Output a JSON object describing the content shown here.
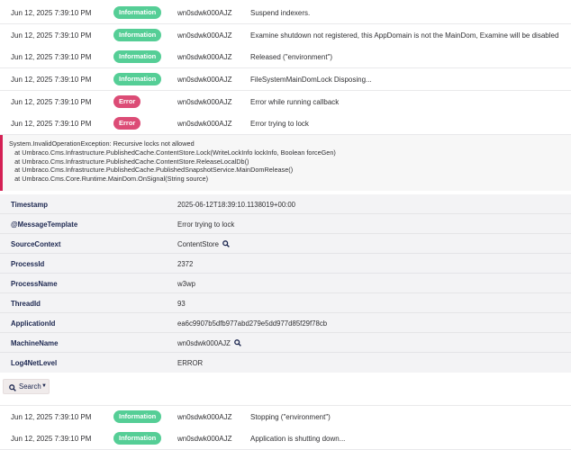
{
  "log_rows_top": [
    {
      "timestamp": "Jun 12, 2025 7:39:10 PM",
      "level": "Information",
      "machine": "wn0sdwk000AJZ",
      "message": "Suspend indexers."
    },
    {
      "timestamp": "Jun 12, 2025 7:39:10 PM",
      "level": "Information",
      "machine": "wn0sdwk000AJZ",
      "message": "Examine shutdown not registered, this AppDomain is not the MainDom, Examine will be disabled"
    },
    {
      "timestamp": "Jun 12, 2025 7:39:10 PM",
      "level": "Information",
      "machine": "wn0sdwk000AJZ",
      "message": "Released (\"environment\")"
    },
    {
      "timestamp": "Jun 12, 2025 7:39:10 PM",
      "level": "Information",
      "machine": "wn0sdwk000AJZ",
      "message": "FileSystemMainDomLock Disposing..."
    },
    {
      "timestamp": "Jun 12, 2025 7:39:10 PM",
      "level": "Error",
      "machine": "wn0sdwk000AJZ",
      "message": "Error while running callback"
    },
    {
      "timestamp": "Jun 12, 2025 7:39:10 PM",
      "level": "Error",
      "machine": "wn0sdwk000AJZ",
      "message": "Error trying to lock"
    }
  ],
  "exception": {
    "lines": [
      "System.InvalidOperationException: Recursive locks not allowed",
      "   at Umbraco.Cms.Infrastructure.PublishedCache.ContentStore.Lock(WriteLockInfo lockInfo, Boolean forceGen)",
      "   at Umbraco.Cms.Infrastructure.PublishedCache.ContentStore.ReleaseLocalDb()",
      "   at Umbraco.Cms.Infrastructure.PublishedCache.PublishedSnapshotService.MainDomRelease()",
      "   at Umbraco.Cms.Core.Runtime.MainDom.OnSignal(String source)"
    ]
  },
  "properties": [
    {
      "key": "Timestamp",
      "value": "2025-06-12T18:39:10.1138019+00:00",
      "searchable": false
    },
    {
      "key": "@MessageTemplate",
      "value": "Error trying to lock",
      "searchable": false
    },
    {
      "key": "SourceContext",
      "value": "ContentStore",
      "searchable": true
    },
    {
      "key": "ProcessId",
      "value": "2372",
      "searchable": false
    },
    {
      "key": "ProcessName",
      "value": "w3wp",
      "searchable": false
    },
    {
      "key": "ThreadId",
      "value": "93",
      "searchable": false
    },
    {
      "key": "ApplicationId",
      "value": "ea6c9907b5dfb977abd279e5dd977d85f29f78cb",
      "searchable": false
    },
    {
      "key": "MachineName",
      "value": "wn0sdwk000AJZ",
      "searchable": true
    },
    {
      "key": "Log4NetLevel",
      "value": "ERROR",
      "searchable": false
    }
  ],
  "search_button": {
    "label": "Search",
    "icon": "search-icon"
  },
  "log_rows_bottom": [
    {
      "timestamp": "Jun 12, 2025 7:39:10 PM",
      "level": "Information",
      "machine": "wn0sdwk000AJZ",
      "message": "Stopping (\"environment\")"
    },
    {
      "timestamp": "Jun 12, 2025 7:39:10 PM",
      "level": "Information",
      "machine": "wn0sdwk000AJZ",
      "message": "Application is shutting down..."
    }
  ],
  "colors": {
    "information": "#2bc37c",
    "error": "#d42054",
    "text": "#303033",
    "label": "#1b264f"
  }
}
